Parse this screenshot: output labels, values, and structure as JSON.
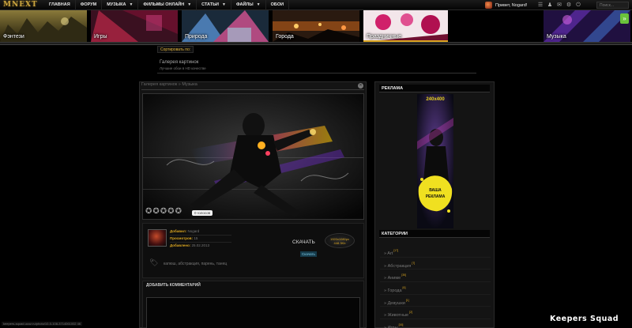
{
  "logo": "MNEXT",
  "nav": [
    {
      "label": "ГЛАВНАЯ",
      "dropdown": false
    },
    {
      "label": "ФОРУМ",
      "dropdown": false
    },
    {
      "label": "МУЗЫКА",
      "dropdown": true
    },
    {
      "label": "ФИЛЬМЫ ОНЛАЙН",
      "dropdown": true
    },
    {
      "label": "СТАТЬИ",
      "dropdown": true
    },
    {
      "label": "ФАЙЛЫ",
      "dropdown": true
    },
    {
      "label": "ОБОИ",
      "dropdown": false
    }
  ],
  "user": {
    "greeting": "Привет, Nogard!"
  },
  "toolbar_icons": [
    "menu-icon",
    "person-icon",
    "mail-icon",
    "gear-icon",
    "exit-icon"
  ],
  "search": {
    "placeholder": "Поиск..."
  },
  "banners": [
    {
      "label": "Фэнтези"
    },
    {
      "label": "Игры"
    },
    {
      "label": "Природа"
    },
    {
      "label": ""
    },
    {
      "label": "Города"
    },
    {
      "label": "Праздничные"
    },
    {
      "label": "Музыка"
    }
  ],
  "sort": {
    "label": "Сортировать по:"
  },
  "gallery": {
    "title": "Галерея картинок",
    "subtitle": "Лучшие обои в HD качестве"
  },
  "breadcrumb": "Галерея картинок » Музыка",
  "votes": "0 голосов",
  "info": {
    "added_by_key": "Добавил:",
    "added_by_val": "Nogard",
    "views_key": "Просмотров:",
    "views_val": "15",
    "added_key": "Добавлено:",
    "added_val": "25.02.2013"
  },
  "download": {
    "label": "СКАЧАТЬ",
    "button": "Скачать",
    "resolution": "1920x1080px",
    "size": "448.3Kb"
  },
  "tags": "капюш, абстракция, парень, танец",
  "comments": {
    "heading": "ДОБАВИТЬ КОММЕНТАРИЙ"
  },
  "sidebar": {
    "ad_heading": "РЕКЛАМА",
    "ad_size": "240x400",
    "ad_text_1": "ВАША",
    "ad_text_2": "РЕКЛАМА",
    "categories_heading": "КАТЕГОРИИ",
    "categories": [
      {
        "name": "» Art",
        "count": "[17]"
      },
      {
        "name": "» Абстракция",
        "count": "[7]"
      },
      {
        "name": "» Аниме",
        "count": "[35]"
      },
      {
        "name": "» Города",
        "count": "[6]"
      },
      {
        "name": "» Девушки",
        "count": "[1]"
      },
      {
        "name": "» Животные",
        "count": "[2]"
      },
      {
        "name": "» Игры",
        "count": "[16]"
      }
    ]
  },
  "status_url": "keepers-squad.ucoz.ru/photo/10-0-108-3714061002 46",
  "watermark": "Keepers Squad"
}
